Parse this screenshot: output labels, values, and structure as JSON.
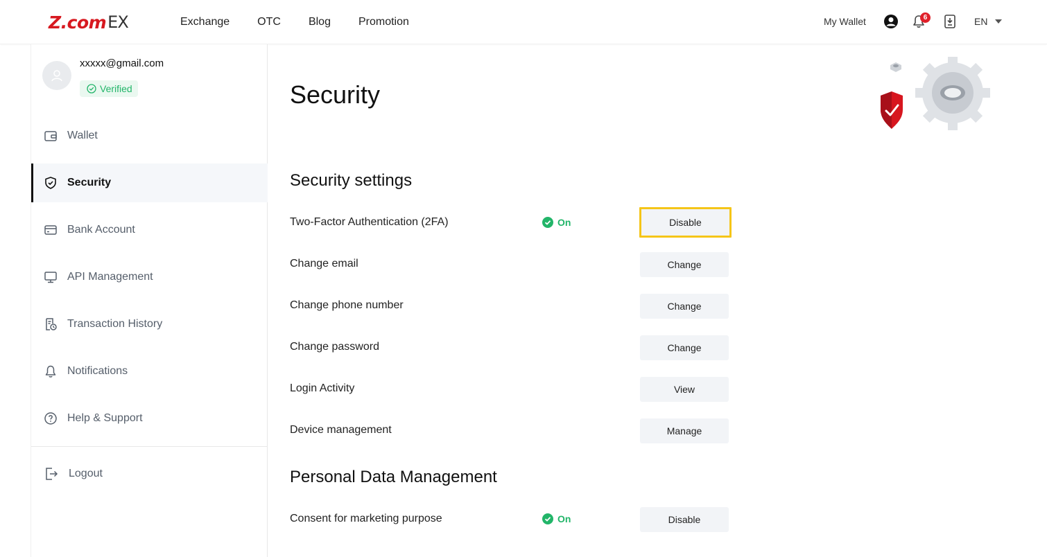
{
  "header": {
    "logo_main": "Z.com",
    "logo_suffix": "EX",
    "nav": [
      "Exchange",
      "OTC",
      "Blog",
      "Promotion"
    ],
    "my_wallet": "My Wallet",
    "notification_count": "6",
    "language": "EN"
  },
  "sidebar": {
    "email": "xxxxx@gmail.com",
    "verified_label": "Verified",
    "items": [
      {
        "label": "Wallet"
      },
      {
        "label": "Security"
      },
      {
        "label": "Bank Account"
      },
      {
        "label": "API Management"
      },
      {
        "label": "Transaction History"
      },
      {
        "label": "Notifications"
      },
      {
        "label": "Help & Support"
      }
    ],
    "logout_label": "Logout"
  },
  "main": {
    "title": "Security",
    "security_settings": {
      "heading": "Security settings",
      "rows": [
        {
          "label": "Two-Factor Authentication (2FA)",
          "status": "On",
          "button": "Disable"
        },
        {
          "label": "Change email",
          "button": "Change"
        },
        {
          "label": "Change phone number",
          "button": "Change"
        },
        {
          "label": "Change password",
          "button": "Change"
        },
        {
          "label": "Login Activity",
          "button": "View"
        },
        {
          "label": "Device management",
          "button": "Manage"
        }
      ]
    },
    "personal_data": {
      "heading": "Personal Data Management",
      "rows": [
        {
          "label": "Consent for marketing purpose",
          "status": "On",
          "button": "Disable"
        }
      ]
    }
  },
  "colors": {
    "brand_red": "#d71920",
    "status_green": "#22b569",
    "highlight_yellow": "#f5c518"
  }
}
